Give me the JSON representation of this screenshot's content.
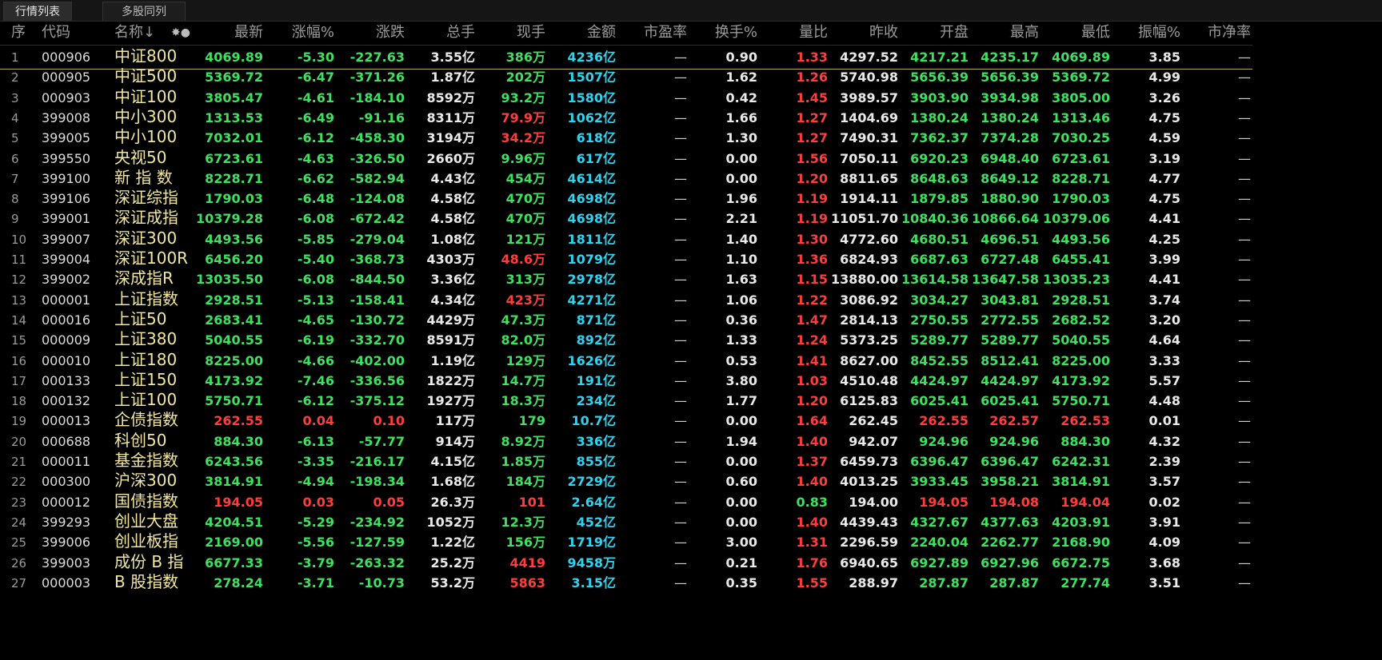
{
  "tabs": [
    "行情列表",
    "多股同列"
  ],
  "header": {
    "seq": "序",
    "code": "代码",
    "name": "名称↓",
    "icons": "✸●",
    "price": "最新",
    "pct": "涨幅%",
    "chg": "涨跌",
    "vol": "总手",
    "cur": "现手",
    "amt": "金额",
    "pe": "市盈率",
    "turn": "换手%",
    "vr": "量比",
    "prev": "昨收",
    "open": "开盘",
    "high": "最高",
    "low": "最低",
    "amp": "振幅%",
    "pb": "市净率"
  },
  "colors": {
    "up": "#ff3d3d",
    "down": "#3ee05f",
    "amount": "#2fd3f0",
    "name": "#f1e7a0"
  },
  "rows": [
    {
      "seq": "1",
      "code": "000906",
      "name": "中证800",
      "price": "4069.89",
      "pct": "-5.30",
      "chg": "-227.63",
      "vol": "3.55亿",
      "cur": "386万",
      "amt": "4236亿",
      "pe": "—",
      "turn": "0.90",
      "vr": "1.33",
      "prev": "4297.52",
      "open": "4217.21",
      "high": "4235.17",
      "low": "4069.89",
      "amp": "3.85",
      "pb": "—"
    },
    {
      "seq": "2",
      "code": "000905",
      "name": "中证500",
      "price": "5369.72",
      "pct": "-6.47",
      "chg": "-371.26",
      "vol": "1.87亿",
      "cur": "202万",
      "amt": "1507亿",
      "pe": "—",
      "turn": "1.62",
      "vr": "1.26",
      "prev": "5740.98",
      "open": "5656.39",
      "high": "5656.39",
      "low": "5369.72",
      "amp": "4.99",
      "pb": "—"
    },
    {
      "seq": "3",
      "code": "000903",
      "name": "中证100",
      "price": "3805.47",
      "pct": "-4.61",
      "chg": "-184.10",
      "vol": "8592万",
      "cur": "93.2万",
      "amt": "1580亿",
      "pe": "—",
      "turn": "0.42",
      "vr": "1.45",
      "prev": "3989.57",
      "open": "3903.90",
      "high": "3934.98",
      "low": "3805.00",
      "amp": "3.26",
      "pb": "—"
    },
    {
      "seq": "4",
      "code": "399008",
      "name": "中小300",
      "price": "1313.53",
      "pct": "-6.49",
      "chg": "-91.16",
      "vol": "8311万",
      "cur": "79.9万",
      "amt": "1062亿",
      "pe": "—",
      "turn": "1.66",
      "vr": "1.27",
      "prev": "1404.69",
      "open": "1380.24",
      "high": "1380.24",
      "low": "1313.46",
      "amp": "4.75",
      "pb": "—"
    },
    {
      "seq": "5",
      "code": "399005",
      "name": "中小100",
      "price": "7032.01",
      "pct": "-6.12",
      "chg": "-458.30",
      "vol": "3194万",
      "cur": "34.2万",
      "amt": "618亿",
      "pe": "—",
      "turn": "1.30",
      "vr": "1.27",
      "prev": "7490.31",
      "open": "7362.37",
      "high": "7374.28",
      "low": "7030.25",
      "amp": "4.59",
      "pb": "—"
    },
    {
      "seq": "6",
      "code": "399550",
      "name": "央视50",
      "price": "6723.61",
      "pct": "-4.63",
      "chg": "-326.50",
      "vol": "2660万",
      "cur": "9.96万",
      "amt": "617亿",
      "pe": "—",
      "turn": "0.00",
      "vr": "1.56",
      "prev": "7050.11",
      "open": "6920.23",
      "high": "6948.40",
      "low": "6723.61",
      "amp": "3.19",
      "pb": "—"
    },
    {
      "seq": "7",
      "code": "399100",
      "name": "新 指 数",
      "price": "8228.71",
      "pct": "-6.62",
      "chg": "-582.94",
      "vol": "4.43亿",
      "cur": "454万",
      "amt": "4614亿",
      "pe": "—",
      "turn": "0.00",
      "vr": "1.20",
      "prev": "8811.65",
      "open": "8648.63",
      "high": "8649.12",
      "low": "8228.71",
      "amp": "4.77",
      "pb": "—"
    },
    {
      "seq": "8",
      "code": "399106",
      "name": "深证综指",
      "price": "1790.03",
      "pct": "-6.48",
      "chg": "-124.08",
      "vol": "4.58亿",
      "cur": "470万",
      "amt": "4698亿",
      "pe": "—",
      "turn": "1.96",
      "vr": "1.19",
      "prev": "1914.11",
      "open": "1879.85",
      "high": "1880.90",
      "low": "1790.03",
      "amp": "4.75",
      "pb": "—"
    },
    {
      "seq": "9",
      "code": "399001",
      "name": "深证成指",
      "price": "10379.28",
      "pct": "-6.08",
      "chg": "-672.42",
      "vol": "4.58亿",
      "cur": "470万",
      "amt": "4698亿",
      "pe": "—",
      "turn": "2.21",
      "vr": "1.19",
      "prev": "11051.70",
      "open": "10840.36",
      "high": "10866.64",
      "low": "10379.06",
      "amp": "4.41",
      "pb": "—"
    },
    {
      "seq": "10",
      "code": "399007",
      "name": "深证300",
      "price": "4493.56",
      "pct": "-5.85",
      "chg": "-279.04",
      "vol": "1.08亿",
      "cur": "121万",
      "amt": "1811亿",
      "pe": "—",
      "turn": "1.40",
      "vr": "1.30",
      "prev": "4772.60",
      "open": "4680.51",
      "high": "4696.51",
      "low": "4493.56",
      "amp": "4.25",
      "pb": "—"
    },
    {
      "seq": "11",
      "code": "399004",
      "name": "深证100R",
      "price": "6456.20",
      "pct": "-5.40",
      "chg": "-368.73",
      "vol": "4303万",
      "cur": "48.6万",
      "amt": "1079亿",
      "pe": "—",
      "turn": "1.10",
      "vr": "1.36",
      "prev": "6824.93",
      "open": "6687.63",
      "high": "6727.48",
      "low": "6455.41",
      "amp": "3.99",
      "pb": "—"
    },
    {
      "seq": "12",
      "code": "399002",
      "name": "深成指R",
      "price": "13035.50",
      "pct": "-6.08",
      "chg": "-844.50",
      "vol": "3.36亿",
      "cur": "313万",
      "amt": "2978亿",
      "pe": "—",
      "turn": "1.63",
      "vr": "1.15",
      "prev": "13880.00",
      "open": "13614.58",
      "high": "13647.58",
      "low": "13035.23",
      "amp": "4.41",
      "pb": "—"
    },
    {
      "seq": "13",
      "code": "000001",
      "name": "上证指数",
      "price": "2928.51",
      "pct": "-5.13",
      "chg": "-158.41",
      "vol": "4.34亿",
      "cur": "423万",
      "amt": "4271亿",
      "pe": "—",
      "turn": "1.06",
      "vr": "1.22",
      "prev": "3086.92",
      "open": "3034.27",
      "high": "3043.81",
      "low": "2928.51",
      "amp": "3.74",
      "pb": "—"
    },
    {
      "seq": "14",
      "code": "000016",
      "name": "上证50",
      "price": "2683.41",
      "pct": "-4.65",
      "chg": "-130.72",
      "vol": "4429万",
      "cur": "47.3万",
      "amt": "871亿",
      "pe": "—",
      "turn": "0.36",
      "vr": "1.47",
      "prev": "2814.13",
      "open": "2750.55",
      "high": "2772.55",
      "low": "2682.52",
      "amp": "3.20",
      "pb": "—"
    },
    {
      "seq": "15",
      "code": "000009",
      "name": "上证380",
      "price": "5040.55",
      "pct": "-6.19",
      "chg": "-332.70",
      "vol": "8591万",
      "cur": "82.0万",
      "amt": "892亿",
      "pe": "—",
      "turn": "1.33",
      "vr": "1.24",
      "prev": "5373.25",
      "open": "5289.77",
      "high": "5289.77",
      "low": "5040.55",
      "amp": "4.64",
      "pb": "—"
    },
    {
      "seq": "16",
      "code": "000010",
      "name": "上证180",
      "price": "8225.00",
      "pct": "-4.66",
      "chg": "-402.00",
      "vol": "1.19亿",
      "cur": "129万",
      "amt": "1626亿",
      "pe": "—",
      "turn": "0.53",
      "vr": "1.41",
      "prev": "8627.00",
      "open": "8452.55",
      "high": "8512.41",
      "low": "8225.00",
      "amp": "3.33",
      "pb": "—"
    },
    {
      "seq": "17",
      "code": "000133",
      "name": "上证150",
      "price": "4173.92",
      "pct": "-7.46",
      "chg": "-336.56",
      "vol": "1822万",
      "cur": "14.7万",
      "amt": "191亿",
      "pe": "—",
      "turn": "3.80",
      "vr": "1.03",
      "prev": "4510.48",
      "open": "4424.97",
      "high": "4424.97",
      "low": "4173.92",
      "amp": "5.57",
      "pb": "—"
    },
    {
      "seq": "18",
      "code": "000132",
      "name": "上证100",
      "price": "5750.71",
      "pct": "-6.12",
      "chg": "-375.12",
      "vol": "1927万",
      "cur": "18.3万",
      "amt": "234亿",
      "pe": "—",
      "turn": "1.77",
      "vr": "1.20",
      "prev": "6125.83",
      "open": "6025.41",
      "high": "6025.41",
      "low": "5750.71",
      "amp": "4.48",
      "pb": "—"
    },
    {
      "seq": "19",
      "code": "000013",
      "name": "企债指数",
      "price": "262.55",
      "pct": "0.04",
      "chg": "0.10",
      "vol": "117万",
      "cur": "179",
      "amt": "10.7亿",
      "pe": "—",
      "turn": "0.00",
      "vr": "1.64",
      "prev": "262.45",
      "open": "262.55",
      "high": "262.57",
      "low": "262.53",
      "amp": "0.01",
      "pb": "—"
    },
    {
      "seq": "20",
      "code": "000688",
      "name": "科创50",
      "price": "884.30",
      "pct": "-6.13",
      "chg": "-57.77",
      "vol": "914万",
      "cur": "8.92万",
      "amt": "336亿",
      "pe": "—",
      "turn": "1.94",
      "vr": "1.40",
      "prev": "942.07",
      "open": "924.96",
      "high": "924.96",
      "low": "884.30",
      "amp": "4.32",
      "pb": "—"
    },
    {
      "seq": "21",
      "code": "000011",
      "name": "基金指数",
      "price": "6243.56",
      "pct": "-3.35",
      "chg": "-216.17",
      "vol": "4.15亿",
      "cur": "1.85万",
      "amt": "855亿",
      "pe": "—",
      "turn": "0.00",
      "vr": "1.37",
      "prev": "6459.73",
      "open": "6396.47",
      "high": "6396.47",
      "low": "6242.31",
      "amp": "2.39",
      "pb": "—"
    },
    {
      "seq": "22",
      "code": "000300",
      "name": "沪深300",
      "price": "3814.91",
      "pct": "-4.94",
      "chg": "-198.34",
      "vol": "1.68亿",
      "cur": "184万",
      "amt": "2729亿",
      "pe": "—",
      "turn": "0.60",
      "vr": "1.40",
      "prev": "4013.25",
      "open": "3933.45",
      "high": "3958.21",
      "low": "3814.91",
      "amp": "3.57",
      "pb": "—"
    },
    {
      "seq": "23",
      "code": "000012",
      "name": "国债指数",
      "price": "194.05",
      "pct": "0.03",
      "chg": "0.05",
      "vol": "26.3万",
      "cur": "101",
      "amt": "2.64亿",
      "pe": "—",
      "turn": "0.00",
      "vr": "0.83",
      "prev": "194.00",
      "open": "194.05",
      "high": "194.08",
      "low": "194.04",
      "amp": "0.02",
      "pb": "—"
    },
    {
      "seq": "24",
      "code": "399293",
      "name": "创业大盘",
      "price": "4204.51",
      "pct": "-5.29",
      "chg": "-234.92",
      "vol": "1052万",
      "cur": "12.3万",
      "amt": "452亿",
      "pe": "—",
      "turn": "0.00",
      "vr": "1.40",
      "prev": "4439.43",
      "open": "4327.67",
      "high": "4377.63",
      "low": "4203.91",
      "amp": "3.91",
      "pb": "—"
    },
    {
      "seq": "25",
      "code": "399006",
      "name": "创业板指",
      "price": "2169.00",
      "pct": "-5.56",
      "chg": "-127.59",
      "vol": "1.22亿",
      "cur": "156万",
      "amt": "1719亿",
      "pe": "—",
      "turn": "3.00",
      "vr": "1.31",
      "prev": "2296.59",
      "open": "2240.04",
      "high": "2262.77",
      "low": "2168.90",
      "amp": "4.09",
      "pb": "—"
    },
    {
      "seq": "26",
      "code": "399003",
      "name": "成份 B 指",
      "price": "6677.33",
      "pct": "-3.79",
      "chg": "-263.32",
      "vol": "25.2万",
      "cur": "4419",
      "amt": "9458万",
      "pe": "—",
      "turn": "0.21",
      "vr": "1.76",
      "prev": "6940.65",
      "open": "6927.89",
      "high": "6927.96",
      "low": "6672.75",
      "amp": "3.68",
      "pb": "—"
    },
    {
      "seq": "27",
      "code": "000003",
      "name": " B 股指数",
      "price": "278.24",
      "pct": "-3.71",
      "chg": "-10.73",
      "vol": "53.2万",
      "cur": "5863",
      "amt": "3.15亿",
      "pe": "—",
      "turn": "0.35",
      "vr": "1.55",
      "prev": "288.97",
      "open": "287.87",
      "high": "287.87",
      "low": "277.74",
      "amp": "3.51",
      "pb": "—"
    }
  ]
}
